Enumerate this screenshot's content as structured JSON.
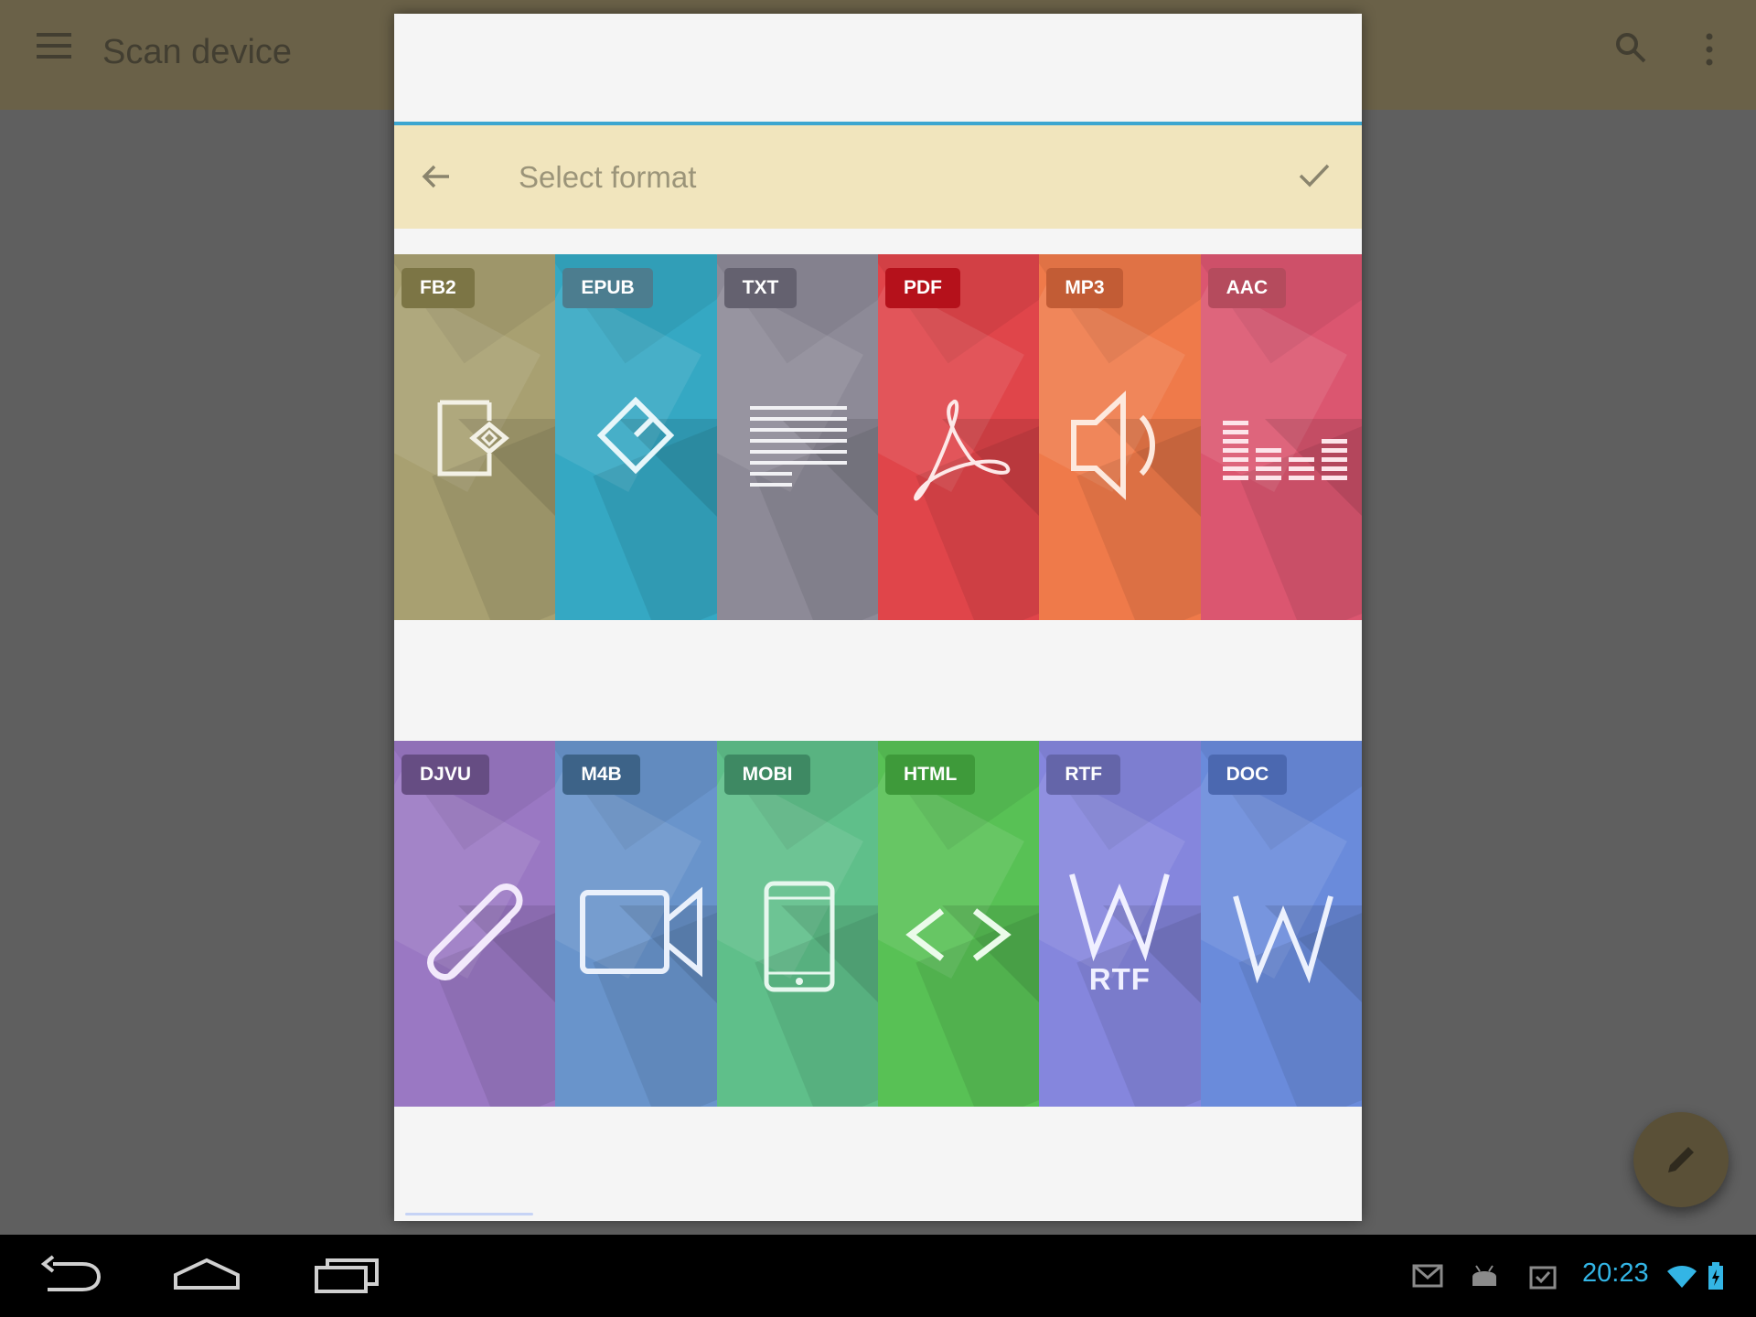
{
  "app": {
    "title": "Scan device"
  },
  "dialog": {
    "title": "Select format",
    "back_icon": "arrow-left-icon",
    "confirm_icon": "check-icon"
  },
  "formats_row1": [
    {
      "label": "FB2",
      "color": "#a8a071",
      "badge_color": "#7c7545",
      "icon": "fb2-book-icon"
    },
    {
      "label": "EPUB",
      "color": "#35a8c3",
      "badge_color": "#4c7d8f",
      "icon": "epub-diamond-icon"
    },
    {
      "label": "TXT",
      "color": "#8d8a97",
      "badge_color": "#64616f",
      "icon": "text-lines-icon"
    },
    {
      "label": "PDF",
      "color": "#e0454a",
      "badge_color": "#b5111b",
      "icon": "acrobat-icon"
    },
    {
      "label": "MP3",
      "color": "#ef7a4a",
      "badge_color": "#c25c35",
      "icon": "speaker-icon"
    },
    {
      "label": "AAC",
      "color": "#db5670",
      "badge_color": "#b54b5d",
      "icon": "equalizer-icon"
    }
  ],
  "formats_row2": [
    {
      "label": "DJVU",
      "color": "#9a78c3",
      "badge_color": "#664d83",
      "icon": "paperclip-icon"
    },
    {
      "label": "M4B",
      "color": "#6994cb",
      "badge_color": "#3d6388",
      "icon": "video-camera-icon"
    },
    {
      "label": "MOBI",
      "color": "#5fbf8a",
      "badge_color": "#3e8963",
      "icon": "phone-icon"
    },
    {
      "label": "HTML",
      "color": "#58c155",
      "badge_color": "#3e9a3a",
      "icon": "code-brackets-icon"
    },
    {
      "label": "RTF",
      "color": "#8586dd",
      "badge_color": "#6465a9",
      "icon": "word-rtf-icon",
      "sublabel": "RTF"
    },
    {
      "label": "DOC",
      "color": "#6a8bdb",
      "badge_color": "#4b68b0",
      "icon": "word-w-icon"
    }
  ],
  "status_bar": {
    "time": "20:23",
    "icons": [
      "gmail-icon",
      "android-icon",
      "clipboard-check-icon",
      "wifi-icon",
      "battery-icon"
    ]
  },
  "nav_bar": {
    "icons": [
      "back-icon",
      "home-icon",
      "recents-icon"
    ]
  },
  "fab": {
    "icon": "pencil-icon"
  }
}
